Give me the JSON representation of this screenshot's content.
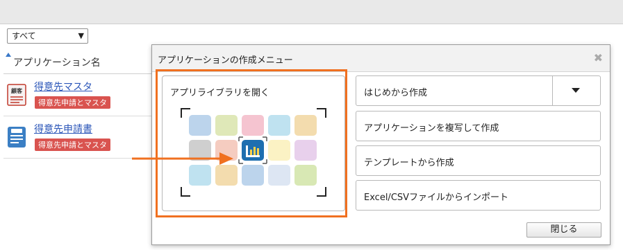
{
  "filter": {
    "selected": "すべて"
  },
  "list": {
    "column_header": "アプリケーション名",
    "apps": [
      {
        "name": "得意先マスタ",
        "tag": "得意先申請とマスタ",
        "icon": "customer-card-icon",
        "icon_text": "顧客"
      },
      {
        "name": "得意先申請書",
        "tag": "得意先申請とマスタ",
        "icon": "form-document-icon"
      }
    ]
  },
  "modal": {
    "title": "アプリケーションの作成メニュー",
    "library_label": "アプリライブラリを開く",
    "actions": {
      "scratch": "はじめから作成",
      "copy": "アプリケーションを複写して作成",
      "template": "テンプレートから作成",
      "import": "Excel/CSVファイルからインポート"
    },
    "close_label": "閉じる"
  },
  "colors": {
    "highlight": "#f07020",
    "tag": "#d9534f",
    "link": "#2a55b8"
  }
}
